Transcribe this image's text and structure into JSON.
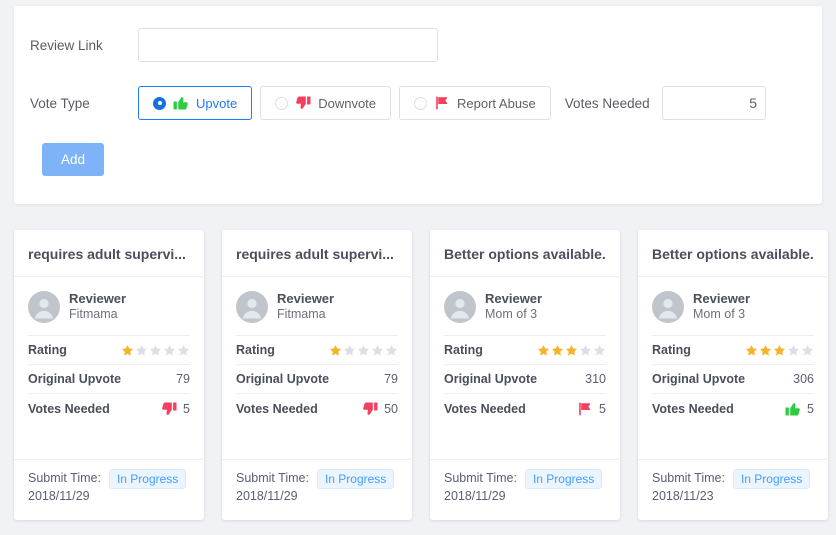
{
  "form": {
    "review_link": {
      "label": "Review Link",
      "value": "",
      "placeholder": ""
    },
    "vote_type": {
      "label": "Vote Type",
      "selected": "Upvote",
      "options": [
        {
          "label": "Upvote",
          "icon": "thumbs-up-icon",
          "icon_color": "#2ecc40",
          "checked": true
        },
        {
          "label": "Downvote",
          "icon": "thumbs-down-icon",
          "icon_color": "#f43f5e",
          "checked": false
        },
        {
          "label": "Report Abuse",
          "icon": "flag-icon",
          "icon_color": "#f43f5e",
          "checked": false
        }
      ]
    },
    "votes_needed": {
      "label": "Votes Needed",
      "value": "5",
      "increment_icon": "chevron-up-icon",
      "decrement_icon": "chevron-down-icon"
    },
    "add_button": {
      "label": "Add",
      "color": "#7eb3f7"
    }
  },
  "cards": [
    {
      "title": "requires adult supervi...",
      "reviewer_title": "Reviewer",
      "reviewer_name": "Fitmama",
      "avatar_icon": "user-avatar-icon",
      "rating_label": "Rating",
      "rating": 1,
      "rating_max": 5,
      "original_upvote_label": "Original Upvote",
      "original_upvote": "79",
      "votes_needed_label": "Votes Needed",
      "votes_needed": "5",
      "vote_icon": "thumbs-down-icon",
      "vote_icon_color": "#f43f5e",
      "submit_time_label": "Submit Time:",
      "submit_time": "2018/11/29",
      "status": "In Progress"
    },
    {
      "title": "requires adult supervi...",
      "reviewer_title": "Reviewer",
      "reviewer_name": "Fitmama",
      "avatar_icon": "user-avatar-icon",
      "rating_label": "Rating",
      "rating": 1,
      "rating_max": 5,
      "original_upvote_label": "Original Upvote",
      "original_upvote": "79",
      "votes_needed_label": "Votes Needed",
      "votes_needed": "50",
      "vote_icon": "thumbs-down-icon",
      "vote_icon_color": "#f43f5e",
      "submit_time_label": "Submit Time:",
      "submit_time": "2018/11/29",
      "status": "In Progress"
    },
    {
      "title": "Better options available.",
      "reviewer_title": "Reviewer",
      "reviewer_name": "Mom of 3",
      "avatar_icon": "user-avatar-icon",
      "rating_label": "Rating",
      "rating": 3,
      "rating_max": 5,
      "original_upvote_label": "Original Upvote",
      "original_upvote": "310",
      "votes_needed_label": "Votes Needed",
      "votes_needed": "5",
      "vote_icon": "flag-icon",
      "vote_icon_color": "#f43f5e",
      "submit_time_label": "Submit Time:",
      "submit_time": "2018/11/29",
      "status": "In Progress"
    },
    {
      "title": "Better options available.",
      "reviewer_title": "Reviewer",
      "reviewer_name": "Mom of 3",
      "avatar_icon": "user-avatar-icon",
      "rating_label": "Rating",
      "rating": 3,
      "rating_max": 5,
      "original_upvote_label": "Original Upvote",
      "original_upvote": "306",
      "votes_needed_label": "Votes Needed",
      "votes_needed": "5",
      "vote_icon": "thumbs-up-icon",
      "vote_icon_color": "#2ecc40",
      "submit_time_label": "Submit Time:",
      "submit_time": "2018/11/23",
      "status": "In Progress"
    }
  ],
  "colors": {
    "page_bg": "#f0f2f5",
    "card_bg": "#ffffff",
    "accent_blue": "#2079f5",
    "star_gold": "#f5b325",
    "star_empty": "#dcdfe6",
    "badge_bg": "#ecf5ff",
    "badge_text": "#409eff"
  }
}
